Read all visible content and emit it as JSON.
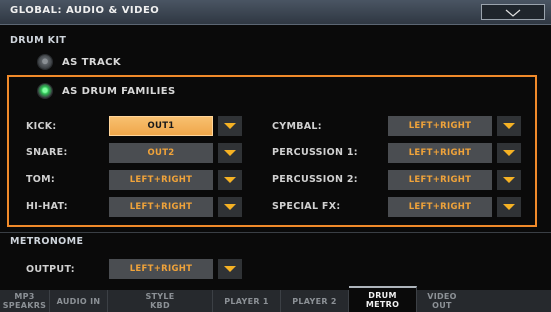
{
  "header": {
    "title": "GLOBAL: AUDIO & VIDEO",
    "menu_icon": "chevron-down-icon"
  },
  "drum_kit": {
    "title": "DRUM KIT",
    "options": [
      {
        "label": "AS TRACK",
        "selected": false
      },
      {
        "label": "AS DRUM FAMILIES",
        "selected": true
      }
    ]
  },
  "families": {
    "left": [
      {
        "label": "KICK:",
        "value": "OUT1",
        "highlighted": true
      },
      {
        "label": "SNARE:",
        "value": "OUT2",
        "highlighted": false
      },
      {
        "label": "TOM:",
        "value": "LEFT+RIGHT",
        "highlighted": false
      },
      {
        "label": "HI-HAT:",
        "value": "LEFT+RIGHT",
        "highlighted": false
      }
    ],
    "right": [
      {
        "label": "CYMBAL:",
        "value": "LEFT+RIGHT"
      },
      {
        "label": "PERCUSSION 1:",
        "value": "LEFT+RIGHT"
      },
      {
        "label": "PERCUSSION 2:",
        "value": "LEFT+RIGHT"
      },
      {
        "label": "SPECIAL FX:",
        "value": "LEFT+RIGHT"
      }
    ]
  },
  "metronome": {
    "title": "METRONOME",
    "output_label": "OUTPUT:",
    "output_value": "LEFT+RIGHT"
  },
  "tabs": [
    {
      "line1": "MP3",
      "line2": "SPEAKRS"
    },
    {
      "line1": "AUDIO IN",
      "line2": ""
    },
    {
      "line1": "STYLE",
      "line2": "KBD"
    },
    {
      "line1": "PLAYER 1",
      "line2": ""
    },
    {
      "line1": "PLAYER 2",
      "line2": ""
    },
    {
      "line1": "DRUM",
      "line2": "METRO",
      "active": true
    },
    {
      "line1": "VIDEO",
      "line2": "OUT"
    }
  ],
  "colors": {
    "accent": "#f08a2a",
    "value_text": "#f0a33a",
    "selected_field": "#f7c070",
    "radio_on": "#2fbf55"
  }
}
